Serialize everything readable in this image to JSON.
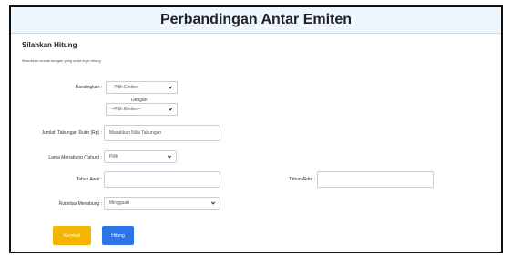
{
  "page": {
    "title": "Perbandingan Antar Emiten",
    "section_title": "Silahkan Hitung",
    "description": "Masukkan sesuai dengan yang anda ingin hitung"
  },
  "form": {
    "compare_label": "Bandingkan :",
    "issuer_select_1": "--Pilih Emiten--",
    "with_label": "Dengan",
    "issuer_select_2": "--Pilih Emiten--",
    "savings_label": "Jumlah Tabungan Rutin (Rp) :",
    "savings_placeholder": "Masukkan Nilai Tabungan",
    "duration_label": "Lama Menabung (Tahun) :",
    "duration_select": "Pilih",
    "start_year_label": "Tahun Awal :",
    "end_year_label": "Tahun Akhir :",
    "routine_label": "Rutinitas Menabung :",
    "routine_select": "Mingguan"
  },
  "buttons": {
    "back": "Kembali",
    "calculate": "Hitung"
  },
  "colors": {
    "back_button": "#f5b400",
    "calculate_button": "#2f74e6",
    "title_bar": "#eef7ff"
  }
}
